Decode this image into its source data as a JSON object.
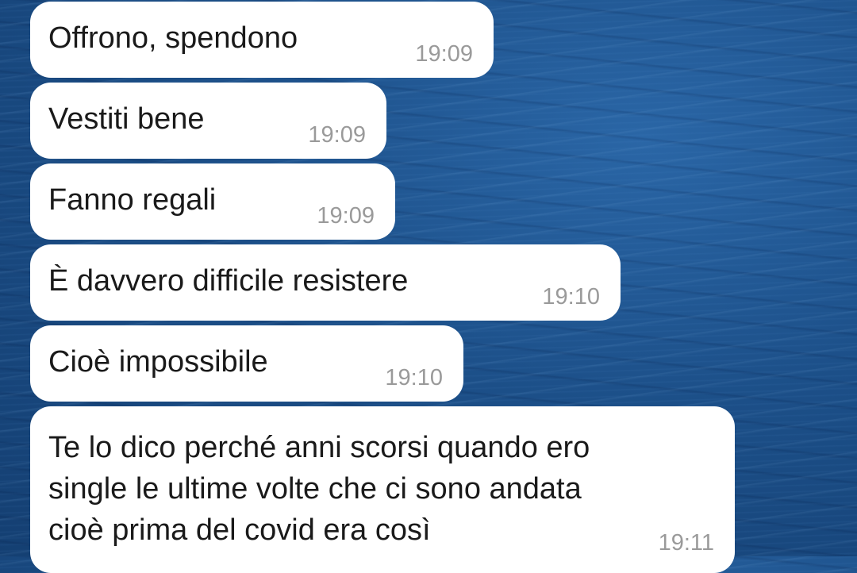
{
  "messages": [
    {
      "text": "Offrono, spendono",
      "time": "19:09"
    },
    {
      "text": "Vestiti bene",
      "time": "19:09"
    },
    {
      "text": "Fanno regali",
      "time": "19:09"
    },
    {
      "text": "È davvero difficile resistere",
      "time": "19:10"
    },
    {
      "text": "Cioè impossibile",
      "time": "19:10"
    },
    {
      "text": "Te lo dico perché anni scorsi quando ero\nsingle le ultime volte che ci sono andata\ncioè prima del covid era così",
      "time": "19:11",
      "lines": [
        "Te lo dico perché anni scorsi quando ero",
        "single le ultime volte che ci sono andata",
        "cioè prima del covid era così"
      ]
    }
  ],
  "background": {
    "description_color": "#1d4f86"
  },
  "colors": {
    "bubble": "#ffffff",
    "text": "#1a1a1a",
    "timestamp": "#9a9a9a"
  }
}
